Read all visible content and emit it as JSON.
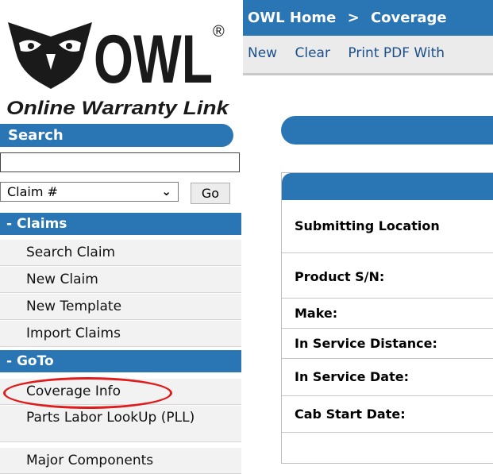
{
  "logo": {
    "brand": "OWL",
    "tagline": "Online Warranty Link",
    "registered": "®"
  },
  "search": {
    "header": "Search",
    "input_value": "",
    "type_selected": "Claim #",
    "go_label": "Go"
  },
  "sidebar": {
    "claims_header": "- Claims",
    "claims_items": [
      "Search Claim",
      "New Claim",
      "New Template",
      "Import Claims"
    ],
    "goto_header": "- GoTo",
    "goto_items": [
      "Coverage Info",
      "Parts Labor LookUp (PLL)",
      "Major Components"
    ]
  },
  "breadcrumb": {
    "home": "OWL Home",
    "separator": ">",
    "current": "Coverage"
  },
  "toolbar": {
    "new_label": "New",
    "clear_label": "Clear",
    "print_label": "Print PDF With"
  },
  "form": {
    "fields": [
      "Submitting Location",
      "Product S/N:",
      "Make:",
      "In Service Distance:",
      "In Service Date:",
      "Cab Start Date:"
    ]
  },
  "colors": {
    "accent": "#2a75b3",
    "highlight": "#e01b1b",
    "menu_bg": "#f2f2f2"
  }
}
